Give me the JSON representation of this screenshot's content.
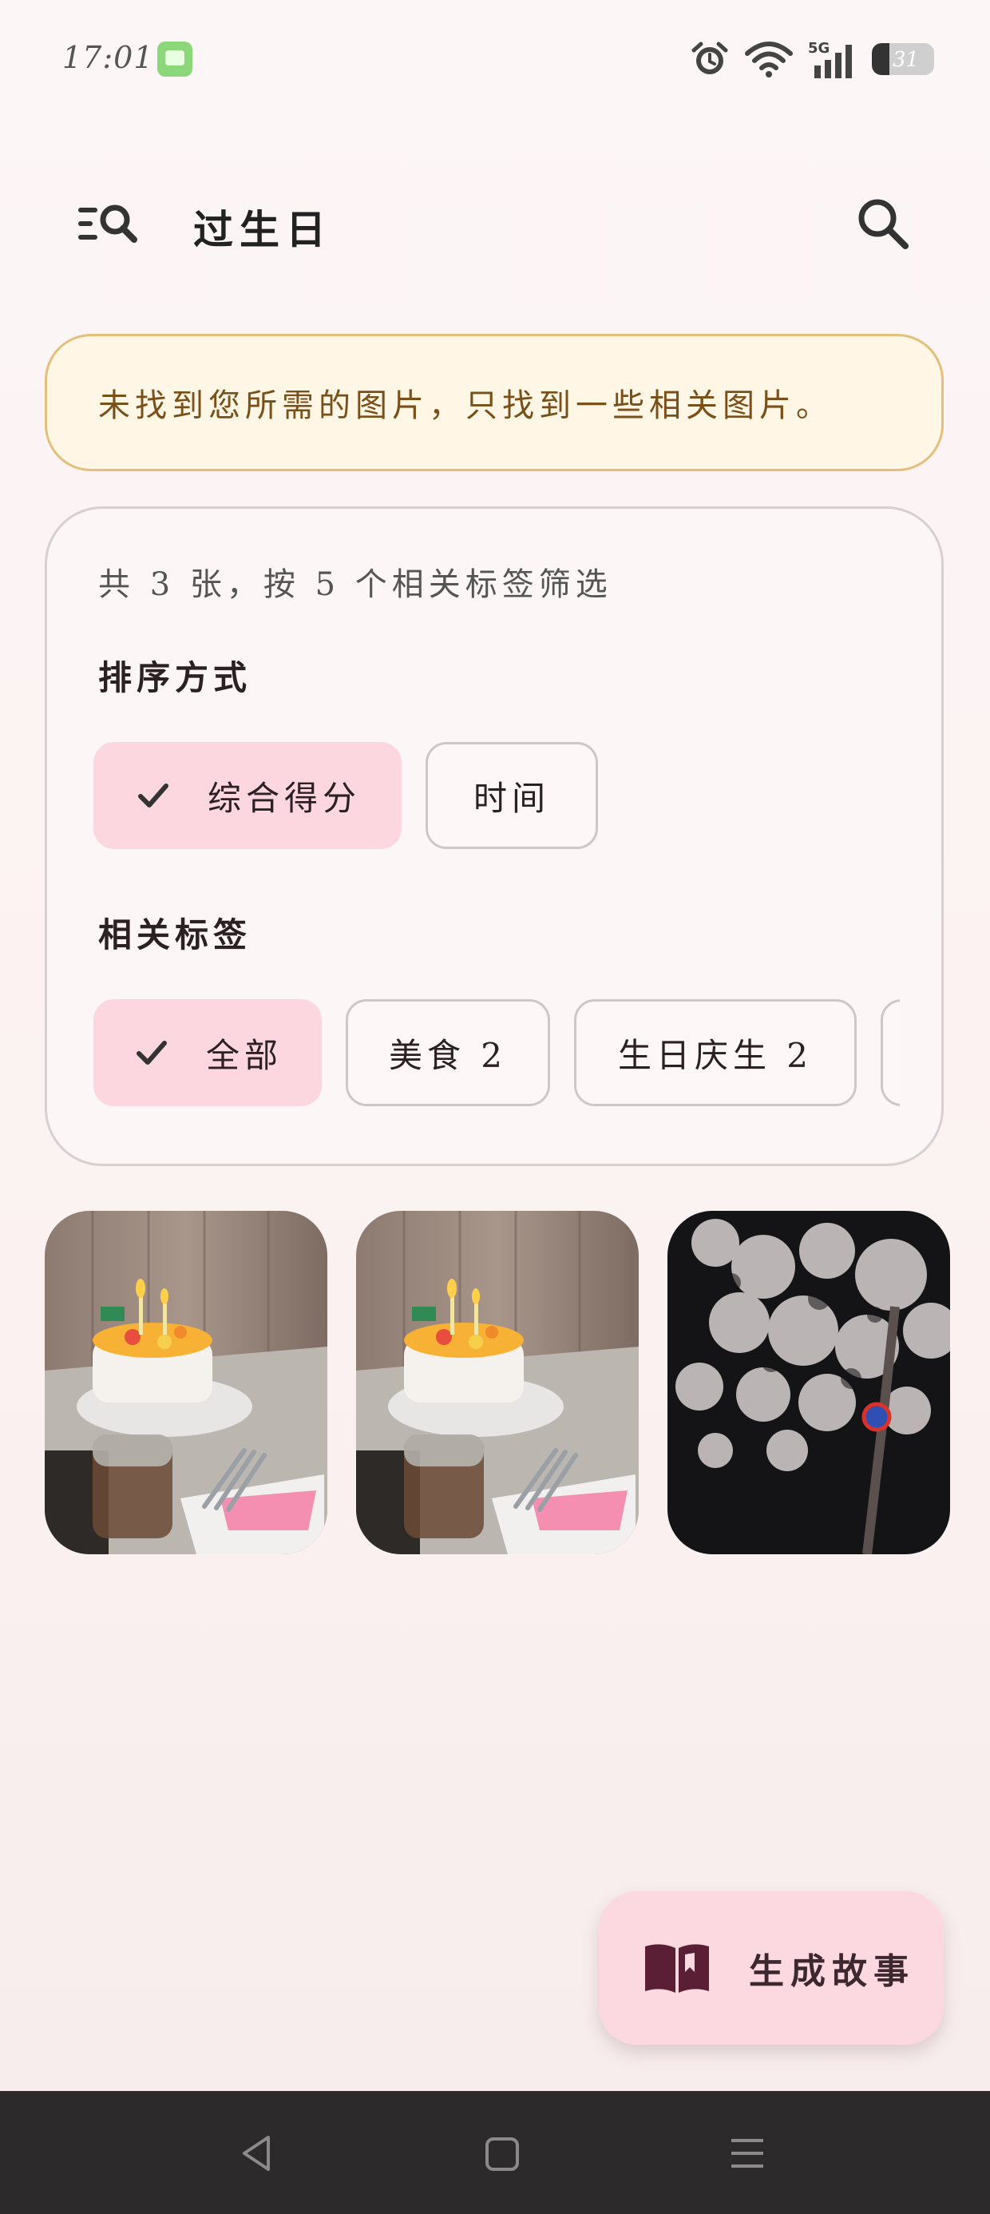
{
  "status_bar": {
    "time": "17:01",
    "battery": "31"
  },
  "header": {
    "title": "过生日"
  },
  "notice": {
    "text": "未找到您所需的图片，只找到一些相关图片。"
  },
  "filter": {
    "summary": "共 3 张，按 5 个相关标签筛选",
    "sort_label": "排序方式",
    "sort_options": [
      {
        "label": "综合得分",
        "selected": true
      },
      {
        "label": "时间",
        "selected": false
      }
    ],
    "tags_label": "相关标签",
    "tags": [
      {
        "label": "全部",
        "selected": true
      },
      {
        "label": "美食 2",
        "selected": false
      },
      {
        "label": "生日庆生 2",
        "selected": false
      }
    ]
  },
  "photos": [
    {
      "subject": "birthday-cake"
    },
    {
      "subject": "birthday-cake"
    },
    {
      "subject": "cherry-blossom-night"
    }
  ],
  "fab": {
    "label": "生成故事",
    "icon": "book-icon"
  },
  "colors": {
    "accent_chip": "#fcd7df",
    "notice_bg": "#fff6e6",
    "notice_border": "#e3bf7c",
    "notice_text": "#7a4f18",
    "fab_bg": "#fcd9e0",
    "navbar_bg": "#2c2a2b"
  }
}
